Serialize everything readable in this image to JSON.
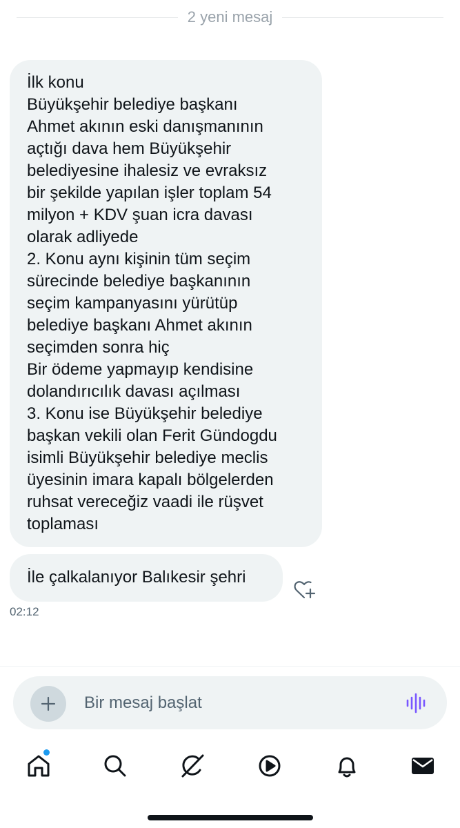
{
  "divider": {
    "label": "2 yeni mesaj"
  },
  "messages": [
    {
      "lines": [
        "İlk konu",
        "Büyükşehir belediye başkanı",
        "Ahmet akının eski danışmanının",
        "açtığı dava hem Büyükşehir",
        "belediyesine ihalesiz ve evraksız",
        "bir şekilde yapılan işler toplam 54",
        "milyon + KDV şuan icra davası",
        "olarak adliyede",
        "2. Konu aynı kişinin tüm seçim",
        "sürecinde belediye başkanının",
        "seçim kampanyasını yürütüp",
        "belediye başkanı Ahmet akının",
        "seçimden sonra hiç",
        "Bir ödeme yapmayıp kendisine",
        "dolandırıcılık davası açılması",
        "3. Konu ise Büyükşehir belediye",
        "başkan vekili olan Ferit Gündogdu",
        "isimli Büyükşehir belediye meclis",
        "üyesinin imara kapalı bölgelerden",
        "ruhsat vereceğiz vaadi ile rüşvet",
        "toplaması"
      ]
    },
    {
      "text": "İle çalkalanıyor Balıkesir şehri"
    }
  ],
  "timestamp": "02:12",
  "composer": {
    "placeholder": "Bir mesaj başlat"
  },
  "icons": {
    "react": "heart-plus-icon",
    "add": "plus-icon",
    "voice": "voice-wave-icon",
    "tabs": [
      "home-icon",
      "search-icon",
      "grok-icon",
      "video-play-icon",
      "bell-icon",
      "mail-icon"
    ]
  },
  "colors": {
    "accent": "#1d9bf0",
    "voice": "#7856ff",
    "bubble": "#eff3f4"
  }
}
